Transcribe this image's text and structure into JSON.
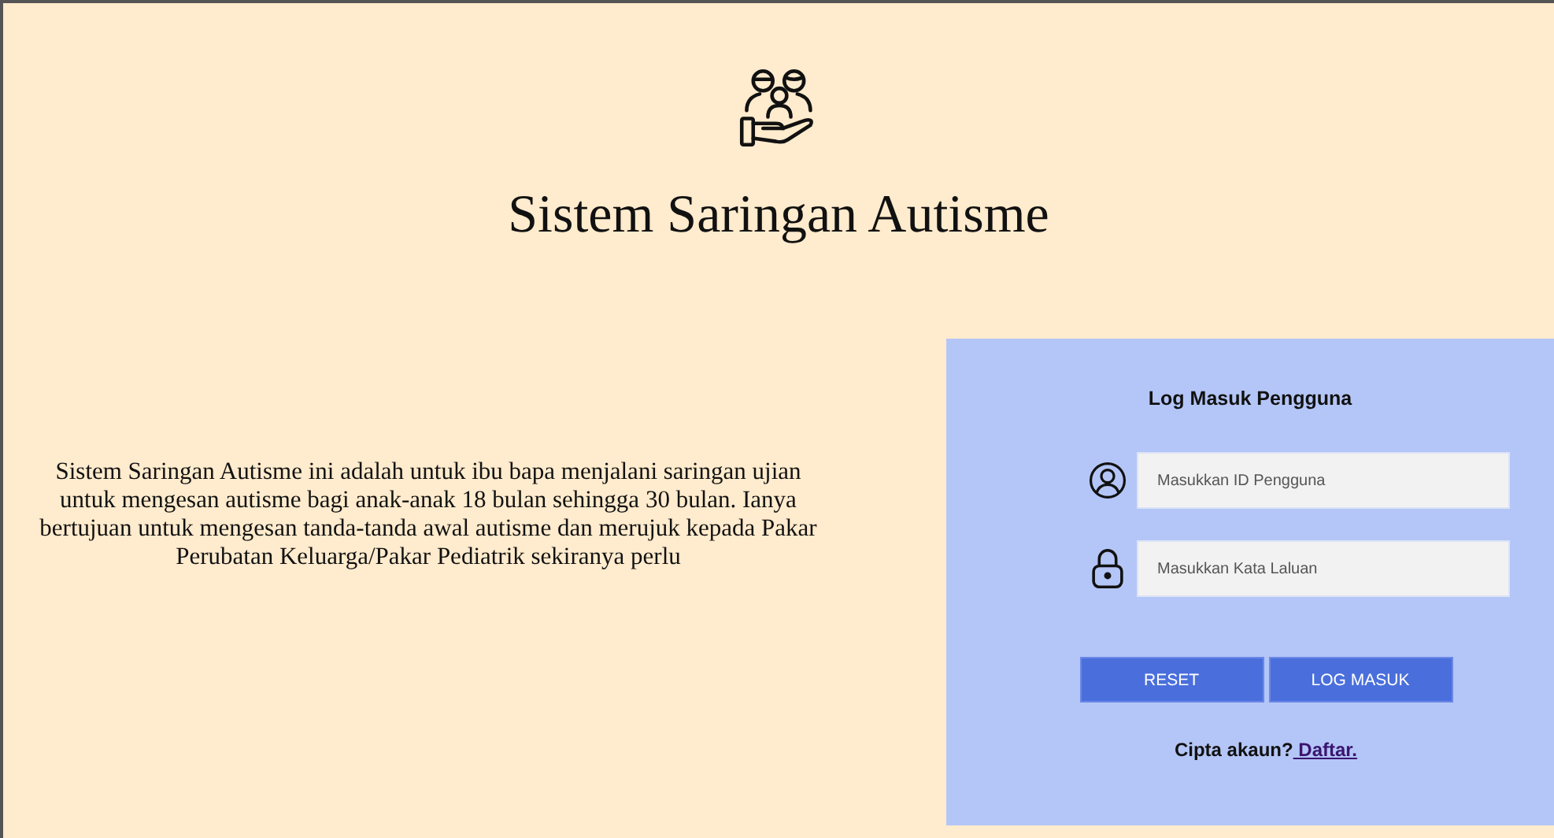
{
  "header": {
    "title": "Sistem Saringan Autisme"
  },
  "description": "Sistem Saringan Autisme ini adalah untuk ibu bapa menjalani saringan ujian untuk mengesan autisme bagi anak-anak 18 bulan sehingga 30 bulan. Ianya bertujuan untuk mengesan tanda-tanda awal autisme dan merujuk kepada Pakar Perubatan Keluarga/Pakar Pediatrik sekiranya perlu",
  "login": {
    "title": "Log Masuk Pengguna",
    "fields": [
      {
        "kind": "user",
        "placeholder": "Masukkan ID Pengguna"
      },
      {
        "kind": "password",
        "placeholder": "Masukkan Kata Laluan"
      }
    ],
    "buttons": [
      "RESET",
      "LOG MASUK"
    ],
    "signup_prompt": "Cipta akaun?",
    "signup_link": " Daftar."
  }
}
